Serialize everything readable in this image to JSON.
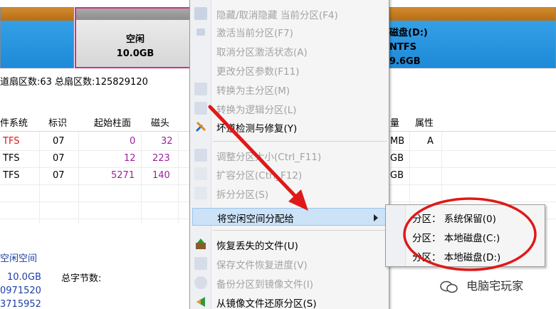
{
  "disk_bar": {
    "free_partition": {
      "label": "空闲",
      "size": "10.0GB"
    },
    "right_partition": {
      "label": "磁盘(D:)",
      "fs_size": "NTFS",
      "size": "9.6GB"
    }
  },
  "info_line": {
    "text": "道扇区数:63  总扇区数:125829120"
  },
  "table": {
    "headers": [
      "件系统",
      "标识",
      "起始柱面",
      "磁头",
      "量",
      "属性"
    ],
    "rows": [
      {
        "fs": "TFS",
        "id": "07",
        "cyl": "0",
        "head": "32",
        "cap": "MB",
        "attr": "A"
      },
      {
        "fs": "TFS",
        "id": "07",
        "cyl": "12",
        "head": "223",
        "cap": "GB",
        "attr": ""
      },
      {
        "fs": "TFS",
        "id": "07",
        "cyl": "5271",
        "head": "140",
        "cap": "GB",
        "attr": ""
      }
    ]
  },
  "details": {
    "title": "空闲空间",
    "size": "10.0GB",
    "v1": "0971520",
    "v2": "3715952",
    "bytes_label": "总字节数:"
  },
  "menu": {
    "items": [
      {
        "label": "隐藏/取消隐藏 当前分区(F4)",
        "enabled": false
      },
      {
        "label": "激活当前分区(F7)",
        "enabled": false
      },
      {
        "label": "取消分区激活状态(A)",
        "enabled": false
      },
      {
        "label": "更改分区参数(F11)",
        "enabled": false
      },
      {
        "label": "转换为主分区(M)",
        "enabled": false
      },
      {
        "label": "转换为逻辑分区(L)",
        "enabled": false
      },
      {
        "label": "坏道检测与修复(Y)",
        "enabled": true
      },
      {
        "label": "调整分区大小(Ctrl_F11)",
        "enabled": false
      },
      {
        "label": "扩容分区(Ctrl_F12)",
        "enabled": false
      },
      {
        "label": "拆分分区(S)",
        "enabled": false
      },
      {
        "label": "将空闲空间分配给",
        "enabled": true,
        "submenu": true
      },
      {
        "label": "恢复丢失的文件(U)",
        "enabled": true
      },
      {
        "label": "保存文件恢复进度(V)",
        "enabled": false
      },
      {
        "label": "备份分区到镜像文件(I)",
        "enabled": false
      },
      {
        "label": "从镜像文件还原分区(S)",
        "enabled": true
      }
    ]
  },
  "submenu": {
    "items": [
      {
        "label": "分区： 系统保留(0)"
      },
      {
        "label": "分区： 本地磁盘(C:)"
      },
      {
        "label": "分区： 本地磁盘(D:)"
      }
    ]
  },
  "watermark": {
    "text": "电脑宅玩家",
    "icon": "wechat-icon"
  },
  "colors": {
    "highlight": "#cce2f7",
    "annotation": "#e01818",
    "free_border": "#d0308a"
  }
}
